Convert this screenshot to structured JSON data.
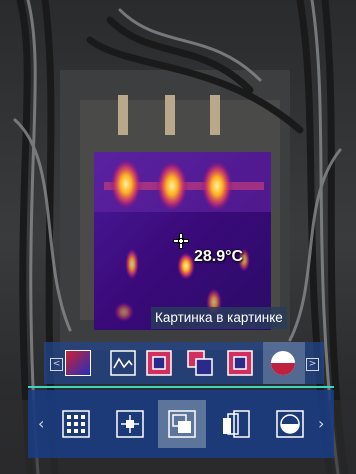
{
  "overlay": {
    "temperature": "28.9°C",
    "tooltip": "Картинка в картинке"
  },
  "palette_bar": {
    "items": [
      {
        "name": "palette-gradient-icon"
      },
      {
        "name": "palette-line-icon"
      },
      {
        "name": "palette-square-icon"
      },
      {
        "name": "palette-double-square-icon"
      },
      {
        "name": "palette-square-selected-icon"
      },
      {
        "name": "palette-half-circle-icon"
      }
    ],
    "selected_index": 4
  },
  "mode_bar": {
    "items": [
      {
        "name": "grid-mode-icon"
      },
      {
        "name": "center-point-mode-icon"
      },
      {
        "name": "pip-mode-icon"
      },
      {
        "name": "blend-mode-icon"
      },
      {
        "name": "half-circle-mode-icon"
      }
    ],
    "selected_index": 2
  },
  "colors": {
    "accent_line": "#3fd3c8",
    "panel": "#1f3d82",
    "thermal_hot": "#ffcc33",
    "thermal_cold": "#3a0a7a"
  }
}
